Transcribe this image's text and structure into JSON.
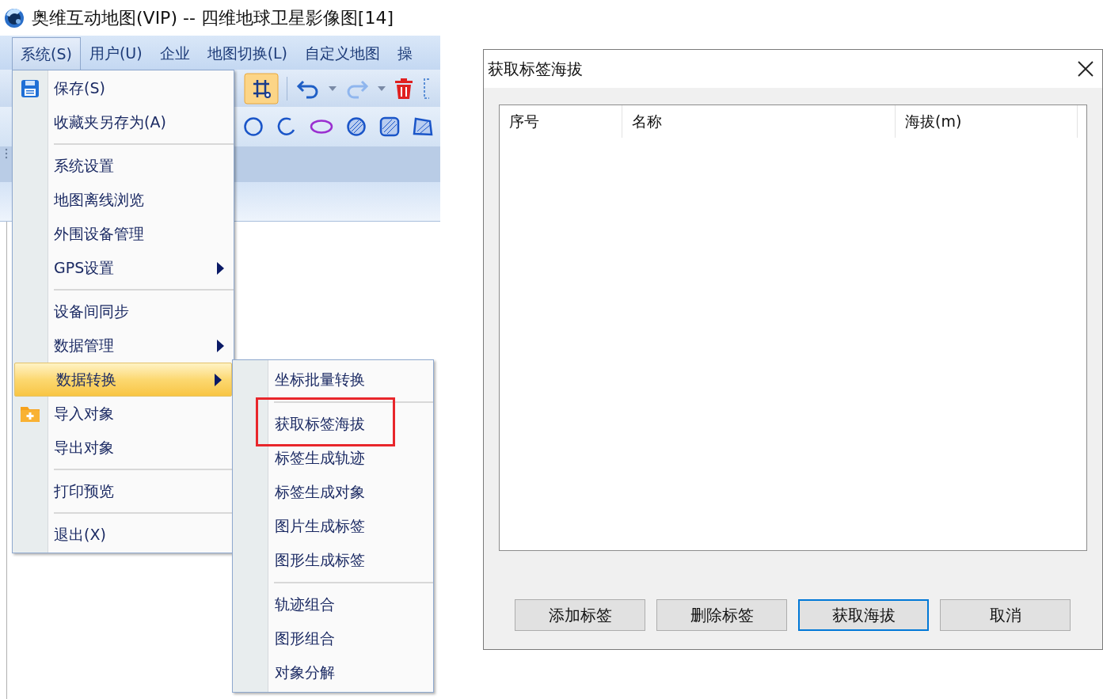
{
  "app": {
    "title": "奥维互动地图(VIP) -- 四维地球卫星影像图[14]",
    "menubar": [
      {
        "label": "系统(S)",
        "selected": true
      },
      {
        "label": "用户(U)",
        "selected": false
      },
      {
        "label": "企业",
        "selected": false
      },
      {
        "label": "地图切换(L)",
        "selected": false
      },
      {
        "label": "自定义地图",
        "selected": false
      },
      {
        "label": "操",
        "selected": false
      }
    ],
    "menu": {
      "items": [
        {
          "kind": "save",
          "label": "保存(S)",
          "has_submenu": false,
          "selected": false
        },
        {
          "kind": "item",
          "label": "收藏夹另存为(A)",
          "has_submenu": false,
          "selected": false
        },
        {
          "kind": "separator"
        },
        {
          "kind": "item",
          "label": "系统设置",
          "has_submenu": false,
          "selected": false
        },
        {
          "kind": "item",
          "label": "地图离线浏览",
          "has_submenu": false,
          "selected": false
        },
        {
          "kind": "item",
          "label": "外围设备管理",
          "has_submenu": false,
          "selected": false
        },
        {
          "kind": "item",
          "label": "GPS设置",
          "has_submenu": true,
          "selected": false
        },
        {
          "kind": "separator"
        },
        {
          "kind": "item",
          "label": "设备间同步",
          "has_submenu": false,
          "selected": false
        },
        {
          "kind": "item",
          "label": "数据管理",
          "has_submenu": true,
          "selected": false
        },
        {
          "kind": "item",
          "label": "数据转换",
          "has_submenu": true,
          "selected": true
        },
        {
          "kind": "import",
          "label": "导入对象",
          "has_submenu": false,
          "selected": false
        },
        {
          "kind": "item",
          "label": "导出对象",
          "has_submenu": false,
          "selected": false
        },
        {
          "kind": "separator"
        },
        {
          "kind": "item",
          "label": "打印预览",
          "has_submenu": false,
          "selected": false
        },
        {
          "kind": "separator"
        },
        {
          "kind": "item",
          "label": "退出(X)",
          "has_submenu": false,
          "selected": false
        }
      ]
    },
    "submenu": {
      "items": [
        {
          "kind": "item",
          "label": "坐标批量转换",
          "annotated": false
        },
        {
          "kind": "separator"
        },
        {
          "kind": "item",
          "label": "获取标签海拔",
          "annotated": true
        },
        {
          "kind": "item",
          "label": "标签生成轨迹",
          "annotated": false
        },
        {
          "kind": "item",
          "label": "标签生成对象",
          "annotated": false
        },
        {
          "kind": "item",
          "label": "图片生成标签",
          "annotated": false
        },
        {
          "kind": "item",
          "label": "图形生成标签",
          "annotated": false
        },
        {
          "kind": "separator"
        },
        {
          "kind": "item",
          "label": "轨迹组合",
          "annotated": false
        },
        {
          "kind": "item",
          "label": "图形组合",
          "annotated": false
        },
        {
          "kind": "item",
          "label": "对象分解",
          "annotated": false
        }
      ]
    }
  },
  "dialog": {
    "title": "获取标签海拔",
    "columns": [
      "序号",
      "名称",
      "海拔(m)"
    ],
    "buttons": [
      {
        "label": "添加标签",
        "focused": false
      },
      {
        "label": "删除标签",
        "focused": false
      },
      {
        "label": "获取海拔",
        "focused": true
      },
      {
        "label": "取消",
        "focused": false
      }
    ]
  }
}
